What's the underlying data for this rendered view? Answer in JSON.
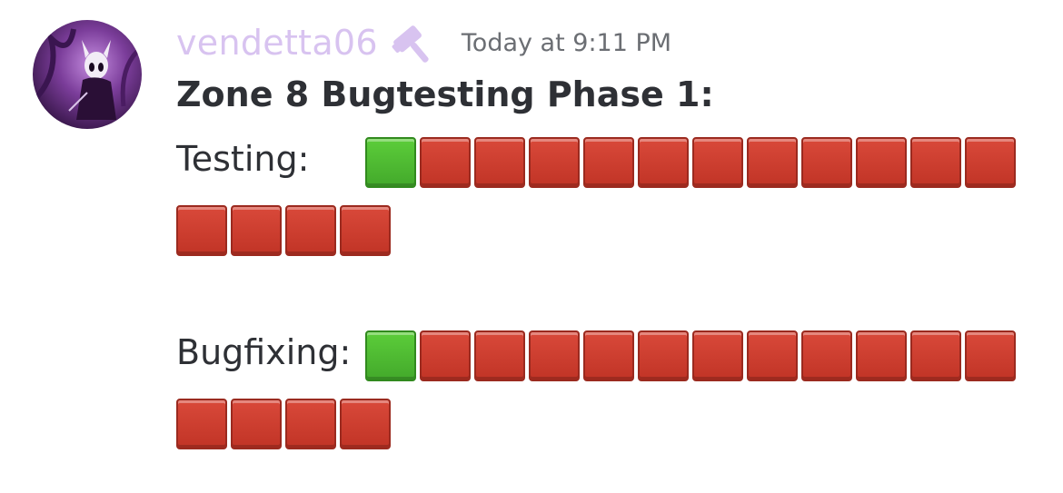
{
  "message": {
    "author": {
      "username": "vendetta06",
      "role_icon": "hammer-icon",
      "username_color": "#d8c3f0"
    },
    "timestamp": "Today at 9:11 PM",
    "title": "Zone 8 Bugtesting Phase 1:",
    "progress": [
      {
        "label": "Testing:",
        "total": 16,
        "completed": 1
      },
      {
        "label": "Bugfixing:",
        "total": 16,
        "completed": 1
      }
    ],
    "colors": {
      "done": "#4cbb31",
      "pending": "#c9392b",
      "text": "#2e3035",
      "timestamp": "#6b6e73"
    }
  }
}
